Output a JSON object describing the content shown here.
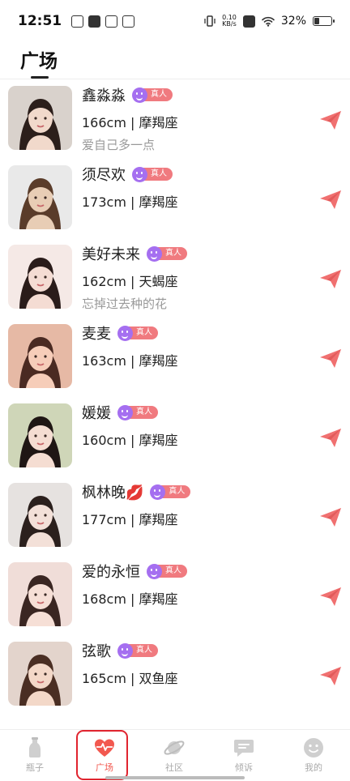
{
  "status_bar": {
    "time": "12:51",
    "net_speed_value": "0.10",
    "net_speed_unit": "KB/s",
    "battery": "32%"
  },
  "header": {
    "title": "广场"
  },
  "badge": {
    "real_label": "真人"
  },
  "users": [
    {
      "name": "鑫淼淼",
      "info": "166cm | 摩羯座",
      "bio": "爱自己多一点",
      "avatar_bg": "#d9d2cc",
      "avatar_skin": "#f1d9cb",
      "avatar_hair": "#2c1f1b"
    },
    {
      "name": "须尽欢",
      "info": "173cm | 摩羯座",
      "bio": "",
      "avatar_bg": "#e9e9e9",
      "avatar_skin": "#e8cdb5",
      "avatar_hair": "#5a3c2a"
    },
    {
      "name": "美好未来",
      "info": "162cm | 天蝎座",
      "bio": "忘掉过去种的花",
      "avatar_bg": "#f5e9e6",
      "avatar_skin": "#f4dcd3",
      "avatar_hair": "#2a1c1a"
    },
    {
      "name": "麦麦",
      "info": "163cm | 摩羯座",
      "bio": "",
      "avatar_bg": "#e6b9a5",
      "avatar_skin": "#f6cdb9",
      "avatar_hair": "#4a2a22"
    },
    {
      "name": "媛媛",
      "info": "160cm | 摩羯座",
      "bio": "",
      "avatar_bg": "#cfd6b8",
      "avatar_skin": "#f5ddd2",
      "avatar_hair": "#1f1614"
    },
    {
      "name": "枫林晚💋",
      "info": "177cm | 摩羯座",
      "bio": "",
      "avatar_bg": "#e6e2e0",
      "avatar_skin": "#f3e0d8",
      "avatar_hair": "#2b201d"
    },
    {
      "name": "爱的永恒",
      "info": "168cm | 摩羯座",
      "bio": "",
      "avatar_bg": "#f0ddd8",
      "avatar_skin": "#f6dfd6",
      "avatar_hair": "#3a2622"
    },
    {
      "name": "弦歌",
      "info": "165cm | 双鱼座",
      "bio": "",
      "avatar_bg": "#e3d4cc",
      "avatar_skin": "#f3d8c8",
      "avatar_hair": "#4a2e23"
    }
  ],
  "tabs": [
    {
      "label": "瓶子",
      "icon": "bottle-icon",
      "active": false
    },
    {
      "label": "广场",
      "icon": "heartbeat-icon",
      "active": true
    },
    {
      "label": "社区",
      "icon": "planet-icon",
      "active": false
    },
    {
      "label": "倾诉",
      "icon": "chat-icon",
      "active": false
    },
    {
      "label": "我的",
      "icon": "smile-icon",
      "active": false
    }
  ],
  "colors": {
    "accent": "#f2584f",
    "send": "#f07070",
    "badge_purple": "#a56ff0",
    "badge_pink": "#f07a7f",
    "tab_inactive": "#c9c9c9"
  }
}
